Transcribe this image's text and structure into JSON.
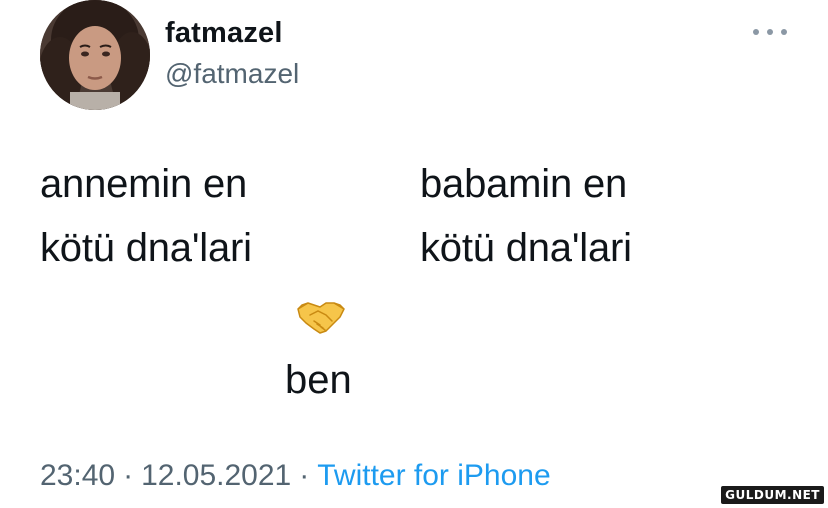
{
  "profile": {
    "display_name": "fatmazel",
    "handle": "@fatmazel"
  },
  "tweet": {
    "left_line1": "annemin en",
    "left_line2": "kötü dna'lari",
    "right_line1": "babamin en",
    "right_line2": "kötü dna'lari",
    "bottom_text": "ben",
    "emoji_icon": "handshake-icon"
  },
  "meta": {
    "time": "23:40",
    "date": "12.05.2021",
    "separator": "·",
    "source": "Twitter for iPhone"
  },
  "watermark": {
    "text": "GULDUM.NET"
  },
  "colors": {
    "text_primary": "#0f1419",
    "text_secondary": "#536471",
    "link": "#1d9bf0"
  }
}
